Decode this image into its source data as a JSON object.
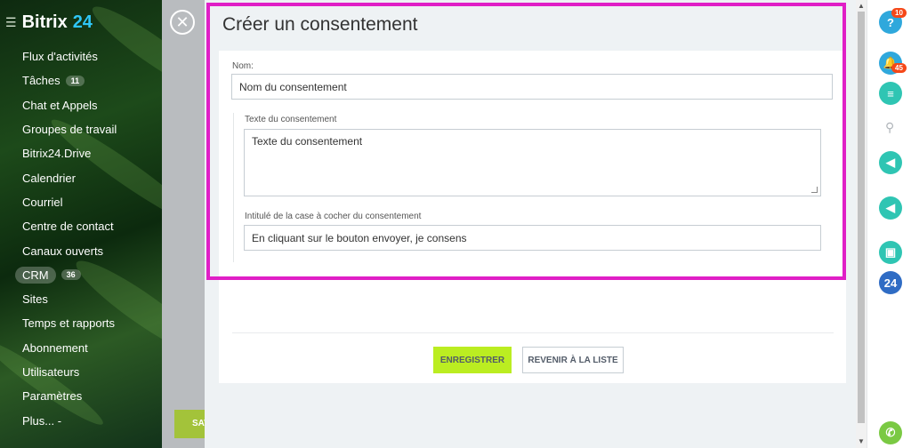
{
  "sidebar": {
    "logo_text": "Bitrix",
    "logo_num": "24",
    "items": [
      {
        "label": "Flux d'activités"
      },
      {
        "label": "Tâches",
        "badge": "11"
      },
      {
        "label": "Chat et Appels"
      },
      {
        "label": "Groupes de travail"
      },
      {
        "label": "Bitrix24.Drive"
      },
      {
        "label": "Calendrier"
      },
      {
        "label": "Courriel"
      },
      {
        "label": "Centre de contact"
      },
      {
        "label": "Canaux ouverts"
      },
      {
        "label": "CRM",
        "badge": "36"
      },
      {
        "label": "Sites"
      },
      {
        "label": "Temps et rapports"
      },
      {
        "label": "Abonnement"
      },
      {
        "label": "Utilisateurs"
      },
      {
        "label": "Paramètres"
      },
      {
        "label": "Plus... -"
      }
    ]
  },
  "background": {
    "save_label": "SAV"
  },
  "slider": {
    "title": "Créer un consentement",
    "name_label": "Nom:",
    "name_value": "Nom du consentement",
    "text_label": "Texte du consentement",
    "text_value": "Texte du consentement",
    "checkbox_label": "Intitulé de la case à cocher du consentement",
    "checkbox_value": "En cliquant sur le bouton envoyer, je consens",
    "save_button": "ENREGISTRER",
    "back_button": "REVENIR À LA LISTE"
  },
  "rail": {
    "help_badge": "10",
    "notif_badge": "45",
    "b24_label": "24"
  },
  "colors": {
    "accent_green": "#bbed21",
    "highlight": "#e01fc6",
    "rail_teal": "#2fc5b3",
    "rail_blue": "#2f6cc4"
  }
}
